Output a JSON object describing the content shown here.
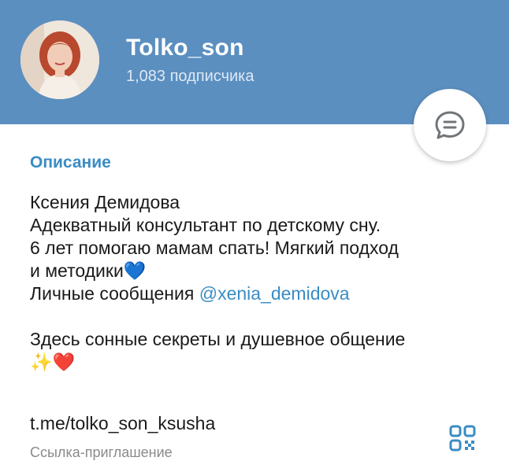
{
  "header": {
    "channel_name": "Tolko_son",
    "subscribers": "1,083 подписчика",
    "background_color": "#5b8fc0",
    "avatar_icon": "profile-photo",
    "message_button_icon": "chat-bubble-icon"
  },
  "description": {
    "section_title": "Описание",
    "lines": [
      "Ксения Демидова",
      "Адекватный консультант по детскому сну.",
      "6 лет помогаю мамам спать! Мягкий подход",
      "и методики💙",
      "Личные сообщения "
    ],
    "mention": "@xenia_demidova",
    "line_after_blank": "Здесь сонные секреты и душевное общение",
    "emoji_line": "✨❤️",
    "accent_color": "#3a8cc4"
  },
  "invite": {
    "link": "t.me/tolko_son_ksusha",
    "label": "Ссылка-приглашение",
    "qr_icon": "qr-code-icon"
  }
}
